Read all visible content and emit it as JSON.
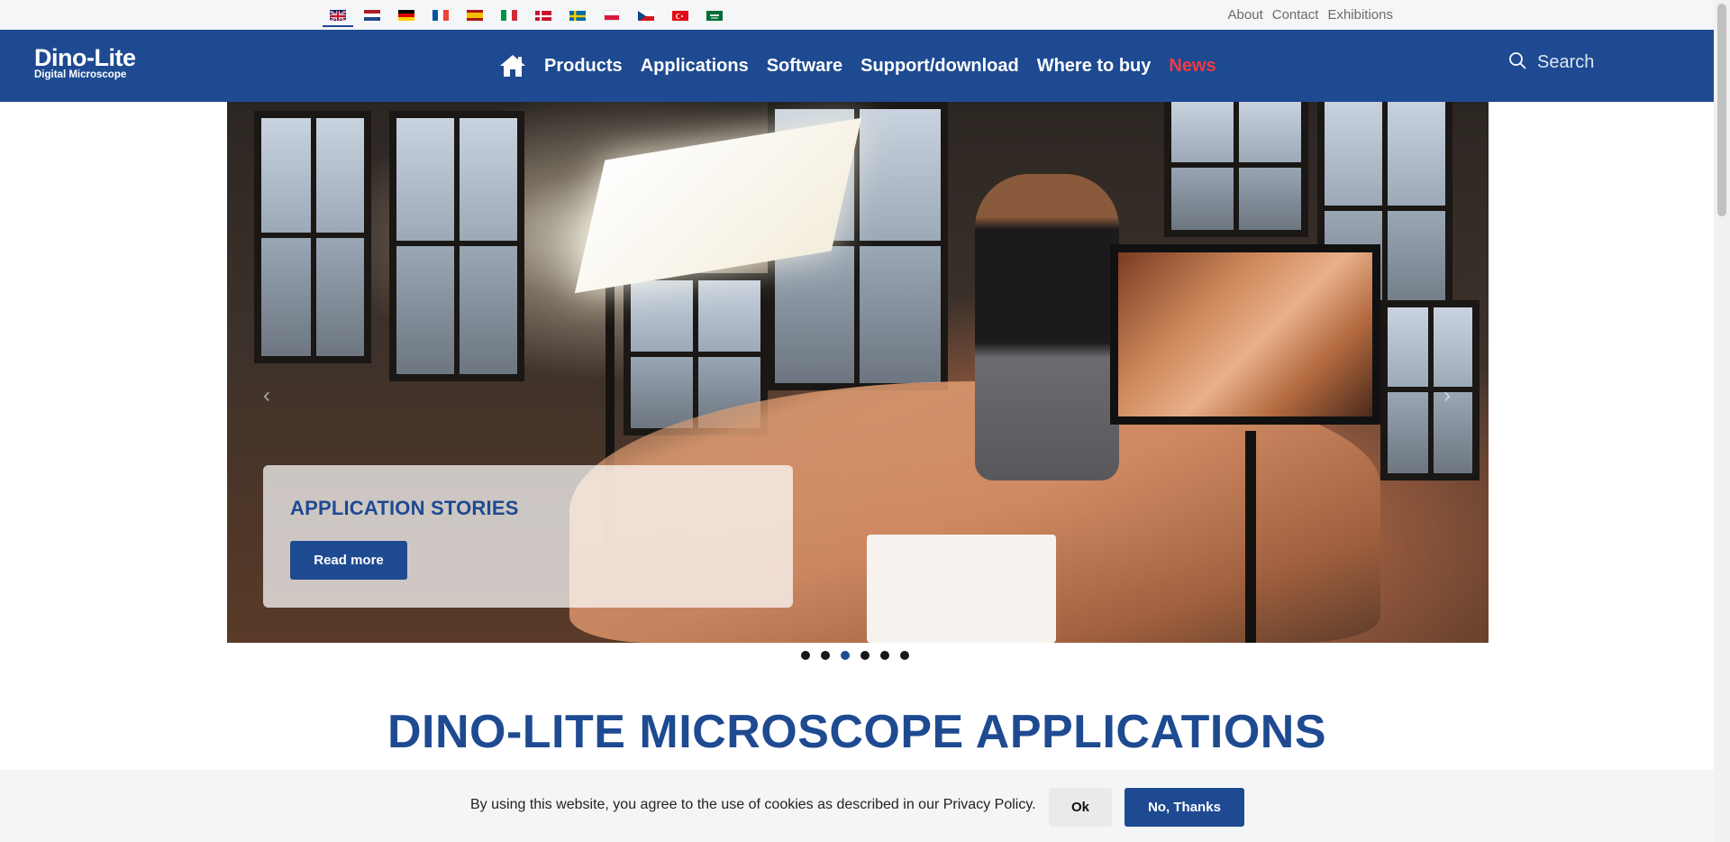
{
  "flags": [
    {
      "name": "flag-uk",
      "label": "English"
    },
    {
      "name": "flag-nl",
      "label": "Nederlands"
    },
    {
      "name": "flag-de",
      "label": "Deutsch"
    },
    {
      "name": "flag-fr",
      "label": "Français"
    },
    {
      "name": "flag-es",
      "label": "Español"
    },
    {
      "name": "flag-it",
      "label": "Italiano"
    },
    {
      "name": "flag-dk",
      "label": "Dansk"
    },
    {
      "name": "flag-se",
      "label": "Svenska"
    },
    {
      "name": "flag-pl",
      "label": "Polski"
    },
    {
      "name": "flag-cz",
      "label": "Čeština"
    },
    {
      "name": "flag-tr",
      "label": "Türkçe"
    },
    {
      "name": "flag-sa",
      "label": "العربية"
    }
  ],
  "toplinks": {
    "about": "About",
    "contact": "Contact",
    "exhibitions": "Exhibitions"
  },
  "logo": {
    "line1": "Dino-Lite",
    "line2": "Digital Microscope"
  },
  "nav": {
    "products": "Products",
    "applications": "Applications",
    "software": "Software",
    "support": "Support/download",
    "where_to_buy": "Where to buy",
    "news": "News"
  },
  "search": {
    "placeholder": "Search"
  },
  "hero": {
    "caption_title": "APPLICATION STORIES",
    "read_more": "Read more",
    "slide_count": 6,
    "active_slide": 3
  },
  "page_heading": "DINO-LITE MICROSCOPE APPLICATIONS",
  "cookie": {
    "text": "By using this website, you agree to the use of cookies as described in our Privacy Policy.",
    "ok": "Ok",
    "no_thanks": "No, Thanks"
  },
  "colors": {
    "brand_blue": "#1e4a91",
    "news_red": "#ee3a43"
  }
}
